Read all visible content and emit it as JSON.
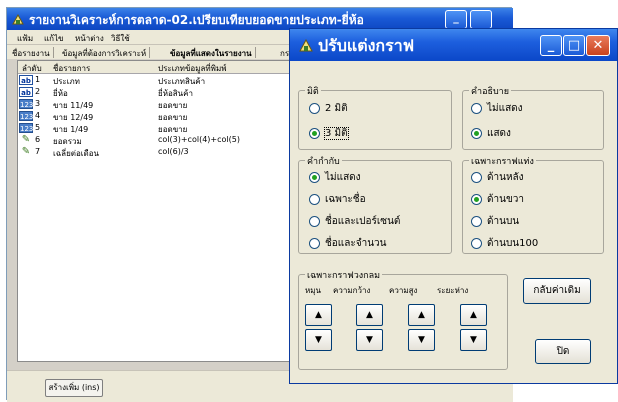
{
  "background_window": {
    "title": "รายงานวิเคราะห์การตลาด-02.เปรียบเทียบยอดขายประเภท-ยี่ห้อ",
    "minimize_symbol": "_",
    "maximize_symbol": "",
    "menu": [
      "แฟ้ม",
      "แก้ไข",
      "หน้าต่าง",
      "วิธีใช้"
    ],
    "tabs": [
      "ชื่อรายงาน",
      "ข้อมูลที่ต้องการวิเคราะห์",
      "ข้อมูลที่แสดงในรายงาน",
      "กรา"
    ],
    "grid_headers": [
      "ลำดับ",
      "ชื่อรายการ",
      "ประเภทข้อมูลที่พิมพ์"
    ],
    "rows": [
      {
        "icon": "ab",
        "num": "1",
        "name": "ประเภท",
        "type": "ประเภทสินค้า"
      },
      {
        "icon": "ab",
        "num": "2",
        "name": "ยี่ห้อ",
        "type": "ยี่ห้อสินค้า"
      },
      {
        "icon": "123",
        "num": "3",
        "name": "ขาย 11/49",
        "type": "ยอดขาย"
      },
      {
        "icon": "123",
        "num": "4",
        "name": "ขาย 12/49",
        "type": "ยอดขาย"
      },
      {
        "icon": "123",
        "num": "5",
        "name": "ขาย 1/49",
        "type": "ยอดขาย"
      },
      {
        "icon": "calc",
        "num": "6",
        "name": "ยอดรวม",
        "type": "col(3)+col(4)+col(5)"
      },
      {
        "icon": "calc",
        "num": "7",
        "name": "เฉลี่ยต่อเดือน",
        "type": "col(6)/3"
      }
    ],
    "bottom_button": "สร้างเพิ่ม (ins)"
  },
  "dialog": {
    "title": "ปรับแต่งกราฟ",
    "controls": {
      "minimize": "_",
      "maximize": "□",
      "close": "✕"
    },
    "groups": {
      "dimension": {
        "label": "มิติ",
        "options": [
          "2 มิติ",
          "3 มิติ"
        ],
        "selected": 1
      },
      "description": {
        "label": "คำอธิบาย",
        "options": [
          "ไม่แสดง",
          "แสดง"
        ],
        "selected": 1
      },
      "label_mode": {
        "label": "คำกำกับ",
        "options": [
          "ไม่แสดง",
          "เฉพาะชื่อ",
          "ชื่อและเปอร์เซนต์",
          "ชื่อและจำนวน"
        ],
        "selected": 0
      },
      "bar_only": {
        "label": "เฉพาะกราฟแท่ง",
        "options": [
          "ด้านหลัง",
          "ด้านขวา",
          "ด้านบน",
          "ด้านบน100"
        ],
        "selected": 1
      },
      "pie_only": {
        "label": "เฉพาะกราฟวงกลม",
        "columns": [
          "หมุน",
          "ความกว้าง",
          "ความสูง",
          "ระยะห่าง"
        ],
        "up_symbol": "▲",
        "down_symbol": "▼"
      }
    },
    "reset_button": "กลับค่าเดิม",
    "close_button": "ปิด"
  },
  "colors": {
    "titlebar_blue": "#1d5fde",
    "dialog_face": "#ece9d8",
    "close_red": "#c9421d",
    "selected_radio": "#21a121"
  }
}
